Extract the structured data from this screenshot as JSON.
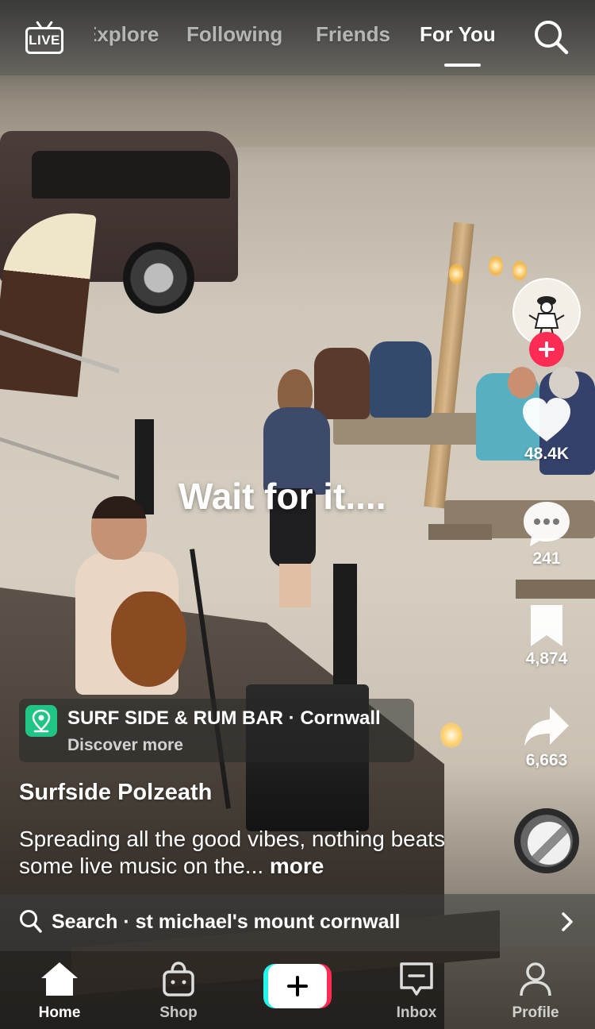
{
  "top_nav": {
    "live_label": "LIVE",
    "tabs": [
      {
        "label": "Explore",
        "active": false
      },
      {
        "label": "Following",
        "active": false
      },
      {
        "label": "Friends",
        "active": false
      },
      {
        "label": "For You",
        "active": true
      }
    ],
    "search_icon": "search-icon"
  },
  "video": {
    "overlay_text": "Wait for it...."
  },
  "actions": {
    "creator_avatar_icon": "creator-avatar",
    "follow_icon": "plus-icon",
    "likes": "48.4K",
    "comments": "241",
    "saves": "4,874",
    "shares": "6,663",
    "sound_disc_icon": "sound-disc"
  },
  "location": {
    "icon": "location-pin-icon",
    "title": "SURF SIDE & RUM BAR · Cornwall",
    "subtitle": "Discover more"
  },
  "caption": {
    "username": "Surfside Polzeath",
    "description": "Spreading all the good vibes, nothing beats some live music on the...",
    "more": "more"
  },
  "search_suggestion": {
    "text": "Search · st michael's mount cornwall"
  },
  "bottom_nav": {
    "items": [
      {
        "label": "Home",
        "icon": "home-icon",
        "active": true
      },
      {
        "label": "Shop",
        "icon": "shop-bag-icon",
        "active": false
      },
      {
        "label": "",
        "icon": "create-plus-icon",
        "active": false
      },
      {
        "label": "Inbox",
        "icon": "inbox-icon",
        "active": false
      },
      {
        "label": "Profile",
        "icon": "profile-icon",
        "active": false
      }
    ]
  },
  "colors": {
    "accent_pink": "#fe2c55",
    "accent_cyan": "#25f4ee",
    "location_green": "#20c586"
  }
}
